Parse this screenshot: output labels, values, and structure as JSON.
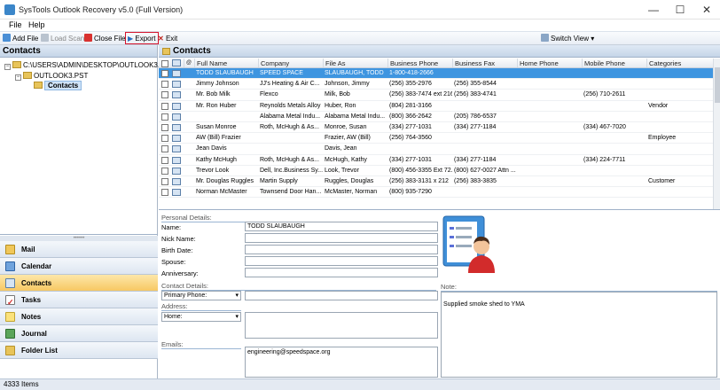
{
  "window": {
    "title": "SysTools Outlook Recovery v5.0 (Full Version)",
    "minimize": "—",
    "maximize": "☐",
    "close": "✕"
  },
  "menu": [
    "File",
    "Help"
  ],
  "toolbar": {
    "add_file": "Add File",
    "load_scan": "Load Scan",
    "close_file": "Close File",
    "export": "Export",
    "exit": "Exit",
    "switch_view": "Switch View ▾"
  },
  "left": {
    "header": "Contacts",
    "tree": [
      {
        "label": "C:\\USERS\\ADMIN\\DESKTOP\\OUTLOOK3.PST"
      },
      {
        "label": "OUTLOOK3.PST"
      },
      {
        "label": "Contacts"
      }
    ],
    "splitter": "••••••",
    "nav": [
      {
        "label": "Mail"
      },
      {
        "label": "Calendar"
      },
      {
        "label": "Contacts"
      },
      {
        "label": "Tasks"
      },
      {
        "label": "Notes"
      },
      {
        "label": "Journal"
      },
      {
        "label": "Folder List"
      }
    ]
  },
  "main": {
    "header": "Contacts",
    "columns": [
      "Full Name",
      "Company",
      "File As",
      "Business Phone",
      "Business Fax",
      "Home Phone",
      "Mobile Phone",
      "Categories"
    ],
    "rows": [
      [
        "TODD SLAUBAUGH",
        "SPEED SPACE",
        "SLAUBAUGH, TODD",
        "1-800-418-2666",
        "",
        "",
        "",
        ""
      ],
      [
        "Jimmy Johnson",
        "JJ's Heating & Air C...",
        "Johnson, Jimmy",
        "(256) 355-2976",
        "(256) 355-8544",
        "",
        "",
        ""
      ],
      [
        "Mr. Bob Milk",
        "Flexco",
        "Milk, Bob",
        "(256) 383-7474 ext 216",
        "(256) 383-4741",
        "",
        "(256) 710-2611",
        ""
      ],
      [
        "Mr. Ron Huber",
        "Reynolds Metals Alloy ...",
        "Huber, Ron",
        "(804) 281-3166",
        "",
        "",
        "",
        "Vendor"
      ],
      [
        "",
        "Alabama Metal Indu...",
        "Alabama Metal Indu...",
        "(800) 366-2642",
        "(205) 786-6537",
        "",
        "",
        ""
      ],
      [
        "Susan Monroe",
        "Roth, McHugh & As...",
        "Monroe, Susan",
        "(334) 277-1031",
        "(334) 277-1184",
        "",
        "(334) 467-7020",
        ""
      ],
      [
        "AW (Bill) Frazier",
        "",
        "Frazier, AW (Bill)",
        "(256) 764-3560",
        "",
        "",
        "",
        "Employee"
      ],
      [
        "Jean Davis",
        "",
        "Davis, Jean",
        "",
        "",
        "",
        "",
        ""
      ],
      [
        "Kathy McHugh",
        "Roth, McHugh & As...",
        "McHugh, Kathy",
        "(334) 277-1031",
        "(334) 277-1184",
        "",
        "(334) 224-7711",
        ""
      ],
      [
        "Trevor Look",
        "Dell, Inc.Business Sy...",
        "Look, Trevor",
        "(800) 456-3355 Ext 72...",
        "(800) 627-0027 Attn ...",
        "",
        "",
        ""
      ],
      [
        "Mr. Douglas Ruggles",
        "Martin Supply",
        "Ruggles, Douglas",
        "(256) 383-3131 x 212",
        "(256) 383-3835",
        "",
        "",
        "Customer"
      ],
      [
        "Norman McMaster",
        "Townsend Door Han...",
        "McMaster, Norman",
        "(800) 935-7290",
        "",
        "",
        "",
        ""
      ]
    ],
    "selected_row": 0
  },
  "details": {
    "personal_section": "Personal Details:",
    "name_label": "Name:",
    "name_value": "TODD SLAUBAUGH",
    "nickname_label": "Nick Name:",
    "birthdate_label": "Birth Date:",
    "spouse_label": "Spouse:",
    "anniversary_label": "Anniversary:",
    "contact_section": "Contact Details:",
    "phone_select": "Primary Phone:",
    "address_section": "Address:",
    "address_select": "Home:",
    "emails_section": "Emails:",
    "email_value": "engineering@speedspace.org",
    "note_label": "Note:",
    "note_value": "Supplied smoke shed to YMA"
  },
  "status": {
    "items": "4333 Items"
  },
  "colors": {
    "selected_row": "#3e95e0",
    "active_nav": "#f7c863",
    "export_outline": "#d4112b"
  }
}
